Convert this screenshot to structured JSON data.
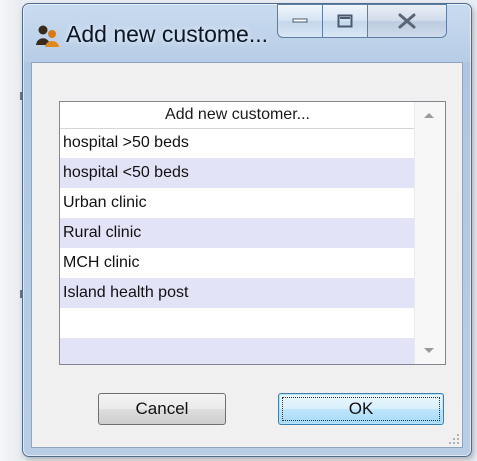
{
  "window": {
    "title": "Add new custome...",
    "icons": {
      "app": "people-icon",
      "minimize": "minimize-icon",
      "maximize": "maximize-icon",
      "close": "close-icon"
    }
  },
  "list": {
    "header": "Add new customer...",
    "items": [
      "hospital >50 beds",
      "hospital <50 beds",
      "Urban clinic",
      "Rural clinic",
      "MCH clinic",
      "Island health post",
      "",
      ""
    ]
  },
  "buttons": {
    "cancel": "Cancel",
    "ok": "OK"
  },
  "colors": {
    "title_bar": "#c9dbef",
    "list_alt_row": "#e3e3f7",
    "ok_button": "#bee6fd"
  }
}
